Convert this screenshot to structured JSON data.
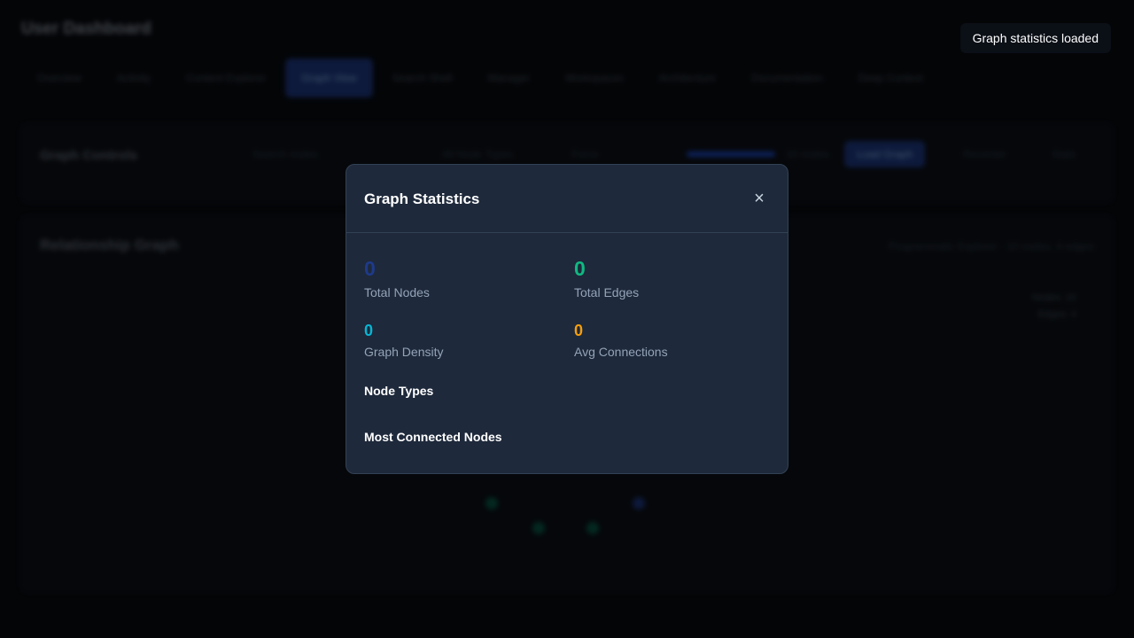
{
  "app": {
    "title": "User Dashboard"
  },
  "tabs": [
    {
      "label": "Overview"
    },
    {
      "label": "Activity"
    },
    {
      "label": "Content Explorer"
    },
    {
      "label": "Graph View",
      "active": true
    },
    {
      "label": "Search Shell"
    },
    {
      "label": "Manager"
    },
    {
      "label": "Workspaces"
    },
    {
      "label": "Architecture"
    },
    {
      "label": "Documentation"
    },
    {
      "label": "Deep Context"
    }
  ],
  "graph_controls": {
    "title": "Graph Controls",
    "search_placeholder": "Search nodes",
    "filter_value": "All Node Types",
    "layout_value": "Force",
    "depth_label": "10 nodes",
    "load_button": "Load Graph",
    "reset_button": "Recenter",
    "stats_button": "Stats"
  },
  "graph": {
    "title": "Relationship Graph",
    "subtitle": "Programmatic Explorer · 10 nodes, 4 edges",
    "legend_nodes": "Nodes: 10",
    "legend_edges": "Edges: 4"
  },
  "toast": {
    "message": "Graph statistics loaded"
  },
  "modal": {
    "title": "Graph Statistics",
    "close_symbol": "×",
    "stats": {
      "total_nodes": {
        "value": "0",
        "label": "Total Nodes",
        "color": "#1e3a8a"
      },
      "total_edges": {
        "value": "0",
        "label": "Total Edges",
        "color": "#10b981"
      },
      "graph_density": {
        "value": "0",
        "label": "Graph Density",
        "color": "#06b6d4"
      },
      "avg_connections": {
        "value": "0",
        "label": "Avg Connections",
        "color": "#f59e0b"
      }
    },
    "node_types_title": "Node Types",
    "most_connected_title": "Most Connected Nodes"
  },
  "colors": {
    "background": "#05070a",
    "modal_bg": "#1e293b",
    "modal_border": "#334155",
    "accent_blue": "#1e3a8a"
  }
}
